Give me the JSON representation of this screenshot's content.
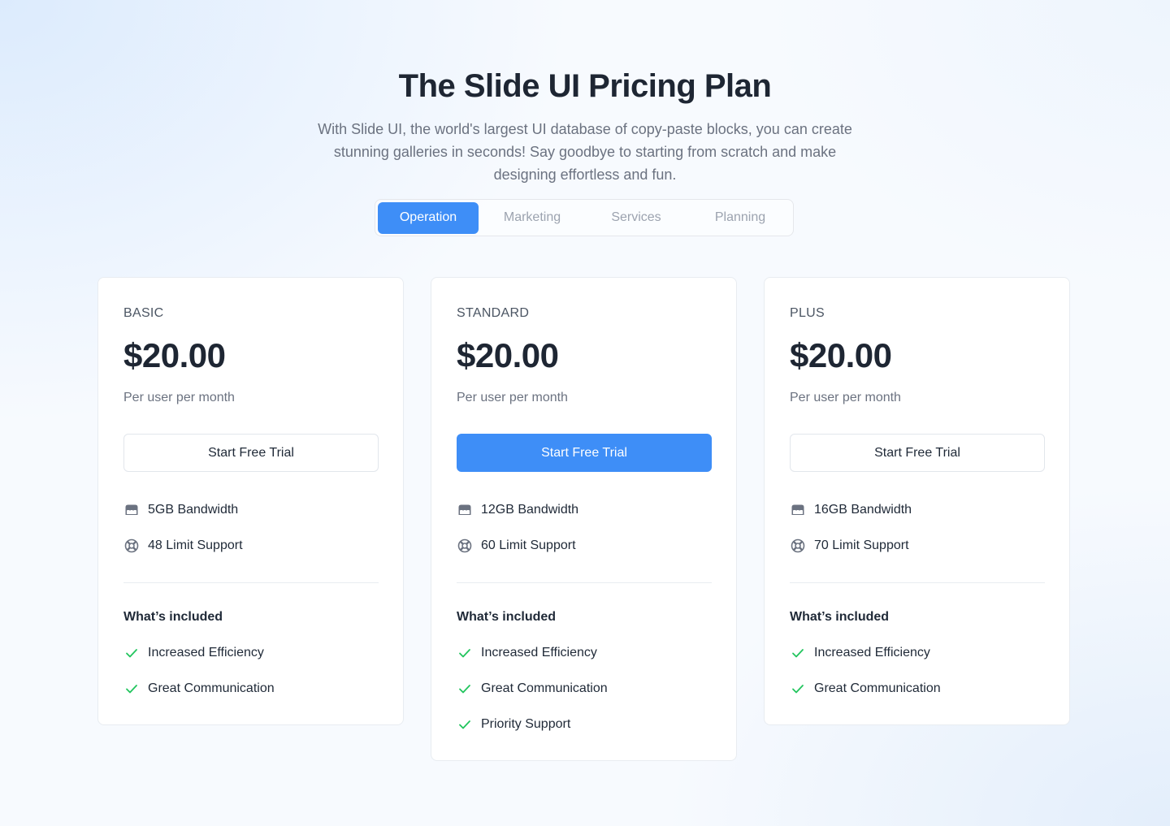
{
  "header": {
    "title": "The Slide UI Pricing Plan",
    "subtitle": "With Slide UI, the world's largest UI database of copy-paste blocks, you can create stunning galleries in seconds! Say goodbye to starting from scratch and make designing effortless and fun."
  },
  "tabs": [
    {
      "label": "Operation",
      "active": true
    },
    {
      "label": "Marketing",
      "active": false
    },
    {
      "label": "Services",
      "active": false
    },
    {
      "label": "Planning",
      "active": false
    }
  ],
  "accent_color": "#3e8ef7",
  "check_color": "#22c55e",
  "plans": [
    {
      "name": "BASIC",
      "price": "$20.00",
      "period": "Per user per month",
      "cta": "Start Free Trial",
      "cta_primary": false,
      "features": [
        {
          "icon": "bandwidth-icon",
          "label": "5GB Bandwidth"
        },
        {
          "icon": "support-icon",
          "label": "48 Limit Support"
        }
      ],
      "included_title": "What’s included",
      "included": [
        "Increased Efficiency",
        "Great Communication"
      ]
    },
    {
      "name": "STANDARD",
      "price": "$20.00",
      "period": "Per user per month",
      "cta": "Start Free Trial",
      "cta_primary": true,
      "features": [
        {
          "icon": "bandwidth-icon",
          "label": "12GB Bandwidth"
        },
        {
          "icon": "support-icon",
          "label": "60 Limit Support"
        }
      ],
      "included_title": "What’s included",
      "included": [
        "Increased Efficiency",
        "Great Communication",
        "Priority Support"
      ]
    },
    {
      "name": "PLUS",
      "price": "$20.00",
      "period": "Per user per month",
      "cta": "Start Free Trial",
      "cta_primary": false,
      "features": [
        {
          "icon": "bandwidth-icon",
          "label": "16GB Bandwidth"
        },
        {
          "icon": "support-icon",
          "label": "70 Limit Support"
        }
      ],
      "included_title": "What’s included",
      "included": [
        "Increased Efficiency",
        "Great Communication"
      ]
    }
  ]
}
